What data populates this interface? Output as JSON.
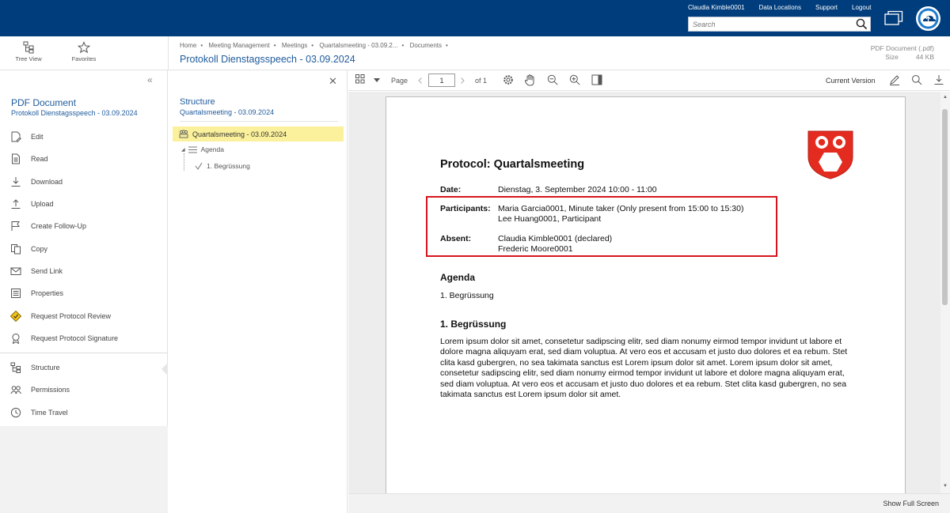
{
  "header": {
    "user": "Claudia Kimble0001",
    "links": [
      "Data Locations",
      "Support",
      "Logout"
    ],
    "search_placeholder": "Search"
  },
  "toolbar": {
    "tree_view": "Tree View",
    "favorites": "Favorites"
  },
  "breadcrumb": [
    "Home",
    "Meeting Management",
    "Meetings",
    "Quartalsmeeting - 03.09.2...",
    "Documents"
  ],
  "document": {
    "title": "Protokoll Dienstagsspeech - 03.09.2024",
    "type": "PDF Document (.pdf)",
    "size_label": "Size",
    "size_value": "44 KB"
  },
  "sidebar": {
    "title": "PDF Document",
    "subtitle": "Protokoll Dienstagsspeech - 03.09.2024",
    "items": [
      {
        "label": "Edit",
        "icon": "edit-icon"
      },
      {
        "label": "Read",
        "icon": "read-icon"
      },
      {
        "label": "Download",
        "icon": "download-icon"
      },
      {
        "label": "Upload",
        "icon": "upload-icon"
      },
      {
        "label": "Create Follow-Up",
        "icon": "flag-icon"
      },
      {
        "label": "Copy",
        "icon": "copy-icon"
      },
      {
        "label": "Send Link",
        "icon": "mail-icon"
      },
      {
        "label": "Properties",
        "icon": "properties-icon"
      },
      {
        "label": "Request Protocol Review",
        "icon": "review-icon"
      },
      {
        "label": "Request Protocol Signature",
        "icon": "signature-icon"
      }
    ],
    "items2": [
      {
        "label": "Structure",
        "icon": "structure-icon"
      },
      {
        "label": "Permissions",
        "icon": "permissions-icon"
      },
      {
        "label": "Time Travel",
        "icon": "time-travel-icon"
      }
    ]
  },
  "structure": {
    "title": "Structure",
    "subtitle": "Quartalsmeeting - 03.09.2024",
    "root": "Quartalsmeeting - 03.09.2024",
    "agenda": "Agenda",
    "item": "1. Begrüssung"
  },
  "viewer": {
    "page_label": "Page",
    "page_value": "1",
    "of_label": "of 1",
    "current_version": "Current Version",
    "show_full_screen": "Show Full Screen"
  },
  "pdf": {
    "title": "Protocol: Quartalsmeeting",
    "date_label": "Date:",
    "date_value": "Dienstag, 3. September 2024 10:00 - 11:00",
    "participants_label": "Participants:",
    "participants": [
      "Maria Garcia0001, Minute taker (Only present from 15:00 to 15:30)",
      "Lee Huang0001, Participant"
    ],
    "absent_label": "Absent:",
    "absent": [
      "Claudia Kimble0001 (declared)",
      "Frederic Moore0001"
    ],
    "agenda_heading": "Agenda",
    "agenda_item": "1. Begrüssung",
    "section_heading": "1. Begrüssung",
    "lorem": "Lorem ipsum dolor sit amet, consetetur sadipscing elitr, sed diam nonumy eirmod tempor invidunt ut labore et dolore magna aliquyam erat, sed diam voluptua. At vero eos et accusam et justo duo dolores et ea rebum. Stet clita kasd gubergren, no sea takimata sanctus est Lorem ipsum dolor sit amet. Lorem ipsum dolor sit amet, consetetur sadipscing elitr, sed diam nonumy eirmod tempor invidunt ut labore et dolore magna aliquyam erat, sed diam voluptua. At vero eos et accusam et justo duo dolores et ea rebum. Stet clita kasd gubergren, no sea takimata sanctus est Lorem ipsum dolor sit amet."
  },
  "colors": {
    "header_bg": "#003d7c",
    "accent": "#1f5b9c",
    "highlight": "#fbf19c",
    "annotation": "#d7141d",
    "crest": "#e42b1f"
  }
}
